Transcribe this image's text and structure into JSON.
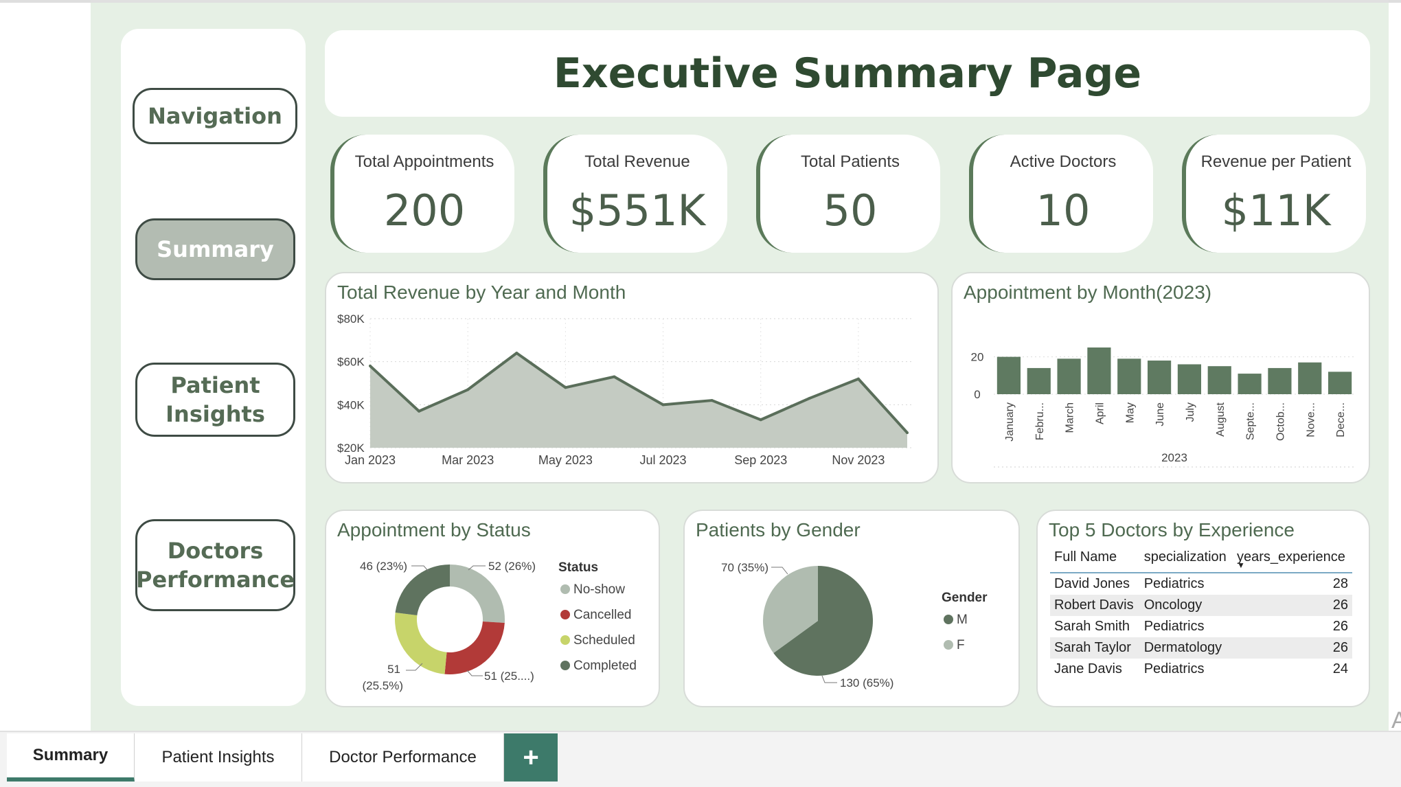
{
  "nav": {
    "items": [
      {
        "label": "Navigation"
      },
      {
        "label": "Summary"
      },
      {
        "label": "Patient Insights"
      },
      {
        "label": "Doctors Performance"
      }
    ]
  },
  "page": {
    "title": "Executive Summary Page"
  },
  "kpis": [
    {
      "label": "Total Appointments",
      "value": "200"
    },
    {
      "label": "Total Revenue",
      "value": "$551K"
    },
    {
      "label": "Total Patients",
      "value": "50"
    },
    {
      "label": "Active Doctors",
      "value": "10"
    },
    {
      "label": "Revenue per Patient",
      "value": "$11K"
    }
  ],
  "colors": {
    "accent": "#5b7a5a",
    "area_fill": "#c4cbc2",
    "line": "#5a6e5a",
    "bar": "#5f7a61",
    "noshow": "#b0bcb0",
    "cancelled": "#b23a38",
    "scheduled": "#c7d46a",
    "completed": "#5f735f",
    "male": "#5f735f",
    "female": "#b0bcb0",
    "table_header_line": "#7aa9c4"
  },
  "chart_data": [
    {
      "type": "area",
      "title": "Total Revenue by Year and Month",
      "x": [
        "Jan 2023",
        "Feb 2023",
        "Mar 2023",
        "Apr 2023",
        "May 2023",
        "Jun 2023",
        "Jul 2023",
        "Aug 2023",
        "Sep 2023",
        "Oct 2023",
        "Nov 2023",
        "Dec 2023"
      ],
      "xticks": [
        "Jan 2023",
        "Mar 2023",
        "May 2023",
        "Jul 2023",
        "Sep 2023",
        "Nov 2023"
      ],
      "values": [
        58,
        37,
        47,
        64,
        48,
        53,
        40,
        42,
        33,
        43,
        52,
        27
      ],
      "yticks": [
        "$80K",
        "$60K",
        "$40K",
        "$20K"
      ],
      "ylim": [
        20,
        80
      ],
      "grid": true
    },
    {
      "type": "bar",
      "title": "Appointment by Month(2023)",
      "categories": [
        "January",
        "Febru...",
        "March",
        "April",
        "May",
        "June",
        "July",
        "August",
        "Septe...",
        "Octob...",
        "Nove...",
        "Dece..."
      ],
      "values": [
        20,
        14,
        19,
        25,
        19,
        18,
        16,
        15,
        11,
        14,
        17,
        12
      ],
      "yticks": [
        "20",
        "0"
      ],
      "xlabel": "2023",
      "ylim": [
        0,
        25
      ]
    },
    {
      "type": "pie",
      "subtype": "donut",
      "title": "Appointment by Status",
      "legend_title": "Status",
      "labels": [
        "No-show",
        "Cancelled",
        "Scheduled",
        "Completed"
      ],
      "values": [
        52,
        51,
        51,
        46
      ],
      "slice_labels": {
        "noshow": "52 (26%)",
        "cancelled": "51 (25....)",
        "scheduled_value": "51",
        "scheduled_pct": "(25.5%)",
        "completed": "46 (23%)"
      }
    },
    {
      "type": "pie",
      "title": "Patients by Gender",
      "legend_title": "Gender",
      "labels": [
        "M",
        "F"
      ],
      "values": [
        130,
        70
      ],
      "slice_labels": {
        "m": "130 (65%)",
        "f": "70 (35%)"
      }
    },
    {
      "type": "table",
      "title": "Top 5 Doctors by Experience",
      "columns": [
        "Full Name",
        "specialization",
        "years_experience"
      ],
      "rows": [
        [
          "David Jones",
          "Pediatrics",
          "28"
        ],
        [
          "Robert Davis",
          "Oncology",
          "26"
        ],
        [
          "Sarah Smith",
          "Pediatrics",
          "26"
        ],
        [
          "Sarah Taylor",
          "Dermatology",
          "26"
        ],
        [
          "Jane Davis",
          "Pediatrics",
          "24"
        ]
      ]
    }
  ],
  "tabs": [
    {
      "label": "Summary"
    },
    {
      "label": "Patient Insights"
    },
    {
      "label": "Doctor Performance"
    }
  ],
  "tab_add": "+",
  "edge_text": "A"
}
